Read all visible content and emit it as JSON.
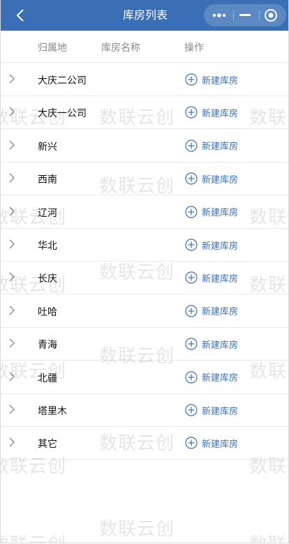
{
  "nav": {
    "title": "库房列表",
    "back_icon": "chevron-left-icon",
    "more_icon": "more-dots-icon",
    "minimize_icon": "minimize-icon",
    "close_icon": "target-circle-icon",
    "bar_color": "#3a6fb6"
  },
  "table": {
    "columns": [
      "归属地",
      "库房名称",
      "操作"
    ],
    "rows": [
      {
        "region": "大庆二公司",
        "warehouse": "",
        "action": "新建库房"
      },
      {
        "region": "大庆一公司",
        "warehouse": "",
        "action": "新建库房"
      },
      {
        "region": "新兴",
        "warehouse": "",
        "action": "新建库房"
      },
      {
        "region": "西南",
        "warehouse": "",
        "action": "新建库房"
      },
      {
        "region": "辽河",
        "warehouse": "",
        "action": "新建库房"
      },
      {
        "region": "华北",
        "warehouse": "",
        "action": "新建库房"
      },
      {
        "region": "长庆",
        "warehouse": "",
        "action": "新建库房"
      },
      {
        "region": "吐哈",
        "warehouse": "",
        "action": "新建库房"
      },
      {
        "region": "青海",
        "warehouse": "",
        "action": "新建库房"
      },
      {
        "region": "北疆",
        "warehouse": "",
        "action": "新建库房"
      },
      {
        "region": "塔里木",
        "warehouse": "",
        "action": "新建库房"
      },
      {
        "region": "其它",
        "warehouse": "",
        "action": "新建库房"
      }
    ]
  },
  "watermark": "数联云创",
  "accent_color": "#3a6fb6"
}
